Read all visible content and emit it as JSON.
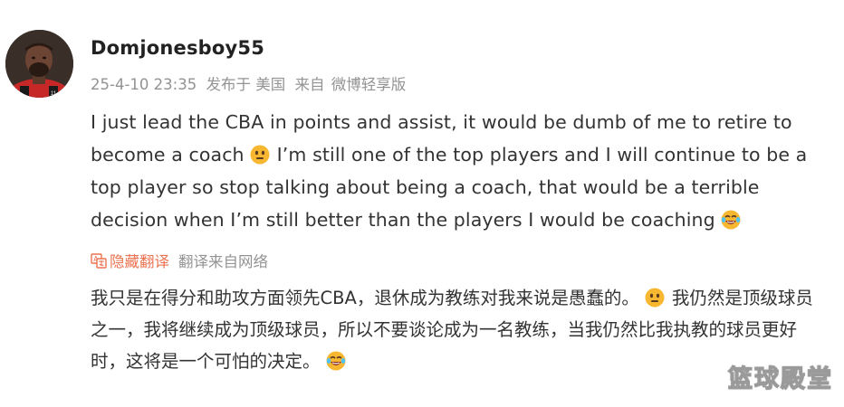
{
  "post": {
    "username": "Domjonesboy55",
    "timestamp": "25-4-10 23:35",
    "posted_in": "发布于 美国",
    "source_label": "来自",
    "source": "微博轻享版",
    "original_text": {
      "part1": "I just lead the CBA in points and assist, it would be dumb of me to retire to become a coach",
      "emoji1": "awkward-face-emoji",
      "part2": "I’m still one of the top players and I will continue to be a top player so stop talking about being a coach, that would be a terrible decision when I’m still better than the players I would be coaching",
      "emoji2": "laughing-tears-emoji"
    },
    "translation": {
      "toggle_label": "隐藏翻译",
      "source_note": "翻译来自网络",
      "part1": "我只是在得分和助攻方面领先CBA，退休成为教练对我来说是愚蠢的。",
      "part2": "我仍然是顶级球员之一，我将继续成为顶级球员，所以不要谈论成为一名教练，当我仍然比我执教的球员更好时，这将是一个可怕的决定。"
    }
  },
  "watermark": "篮球殿堂",
  "colors": {
    "text": "#333333",
    "meta": "#939393",
    "accent": "#eb7350",
    "emoji_face": "#f7b731"
  }
}
